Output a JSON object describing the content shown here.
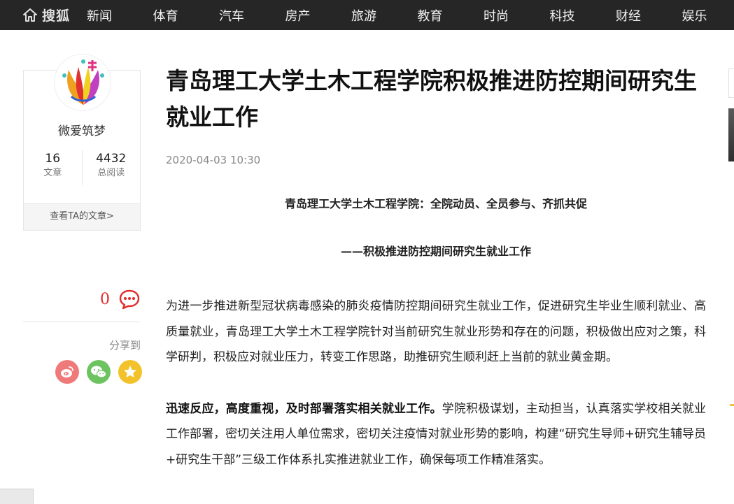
{
  "header": {
    "logo_text": "搜狐",
    "nav": [
      "新闻",
      "体育",
      "汽车",
      "房产",
      "旅游",
      "教育",
      "时尚",
      "科技",
      "财经",
      "娱乐"
    ]
  },
  "author": {
    "name": "微爱筑梦",
    "stats": [
      {
        "value": "16",
        "label": "文章"
      },
      {
        "value": "4432",
        "label": "总阅读"
      }
    ],
    "view_articles": "查看TA的文章>"
  },
  "interactions": {
    "comment_count": "0",
    "share_label": "分享到"
  },
  "article": {
    "title": "青岛理工大学土木工程学院积极推进防控期间研究生就业工作",
    "date": "2020-04-03 10:30",
    "subhead1": "青岛理工大学土木工程学院：全院动员、全员参与、齐抓共促",
    "subhead2": "——积极推进防控期间研究生就业工作",
    "para1": "为进一步推进新型冠状病毒感染的肺炎疫情防控期间研究生就业工作，促进研究生毕业生顺利就业、高质量就业，青岛理工大学土木工程学院针对当前研究生就业形势和存在的问题，积极做出应对之策，科学研判，积极应对就业压力，转变工作思路，助推研究生顺利赶上当前的就业黄金期。",
    "para2_bold": "迅速反应，高度重视，及时部署落实相关就业工作。",
    "para2_text": "学院积极谋划，主动担当，认真落实学校相关就业工作部署，密切关注用人单位需求，密切关注疫情对就业形势的影响，构建“研究生导师+研究生辅导员+研究生干部”三级工作体系扎实推进就业工作，确保每项工作精准落实。"
  },
  "colors": {
    "topbar_bg": "#262626",
    "comment_red": "#e22b2b",
    "weibo": "#f07a7a",
    "wechat": "#6dc35f",
    "favorite": "#f3c22b"
  },
  "icons": [
    "home-icon",
    "comment-icon",
    "weibo-icon",
    "wechat-icon",
    "favorite-icon",
    "avatar-image"
  ]
}
